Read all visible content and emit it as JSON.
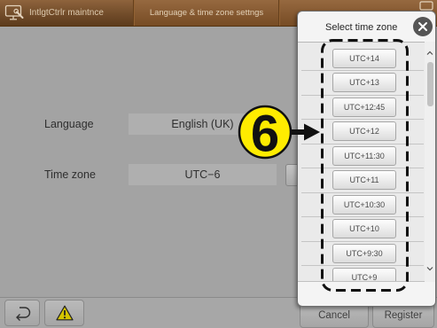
{
  "colors": {
    "header": "#8a582a",
    "close_button": "#555555",
    "warning_fill": "#d4c400",
    "callout_fill": "#ffec00"
  },
  "header": {
    "app_icon": "maintenance-monitor-icon",
    "app_title": "IntlgtCtrlr maintnce",
    "active_tab": "Language & time zone settngs",
    "corner_icon": "window-icon"
  },
  "settings": {
    "language": {
      "label": "Language",
      "value": "English (UK)"
    },
    "time_zone": {
      "label": "Time zone",
      "value": "UTC−6"
    }
  },
  "footer": {
    "back_icon": "return-icon",
    "warning_icon": "warning-icon",
    "cancel_label": "Cancel",
    "register_label": "Register"
  },
  "time_zone_dialog": {
    "title": "Select time zone",
    "close_icon": "close-icon",
    "options": [
      "UTC+14",
      "UTC+13",
      "UTC+12:45",
      "UTC+12",
      "UTC+11:30",
      "UTC+11",
      "UTC+10:30",
      "UTC+10",
      "UTC+9:30",
      "UTC+9"
    ],
    "scroll_up_icon": "chevron-up-icon",
    "scroll_down_icon": "chevron-down-icon",
    "scroll_position": 0
  },
  "callout": {
    "number": "6"
  }
}
